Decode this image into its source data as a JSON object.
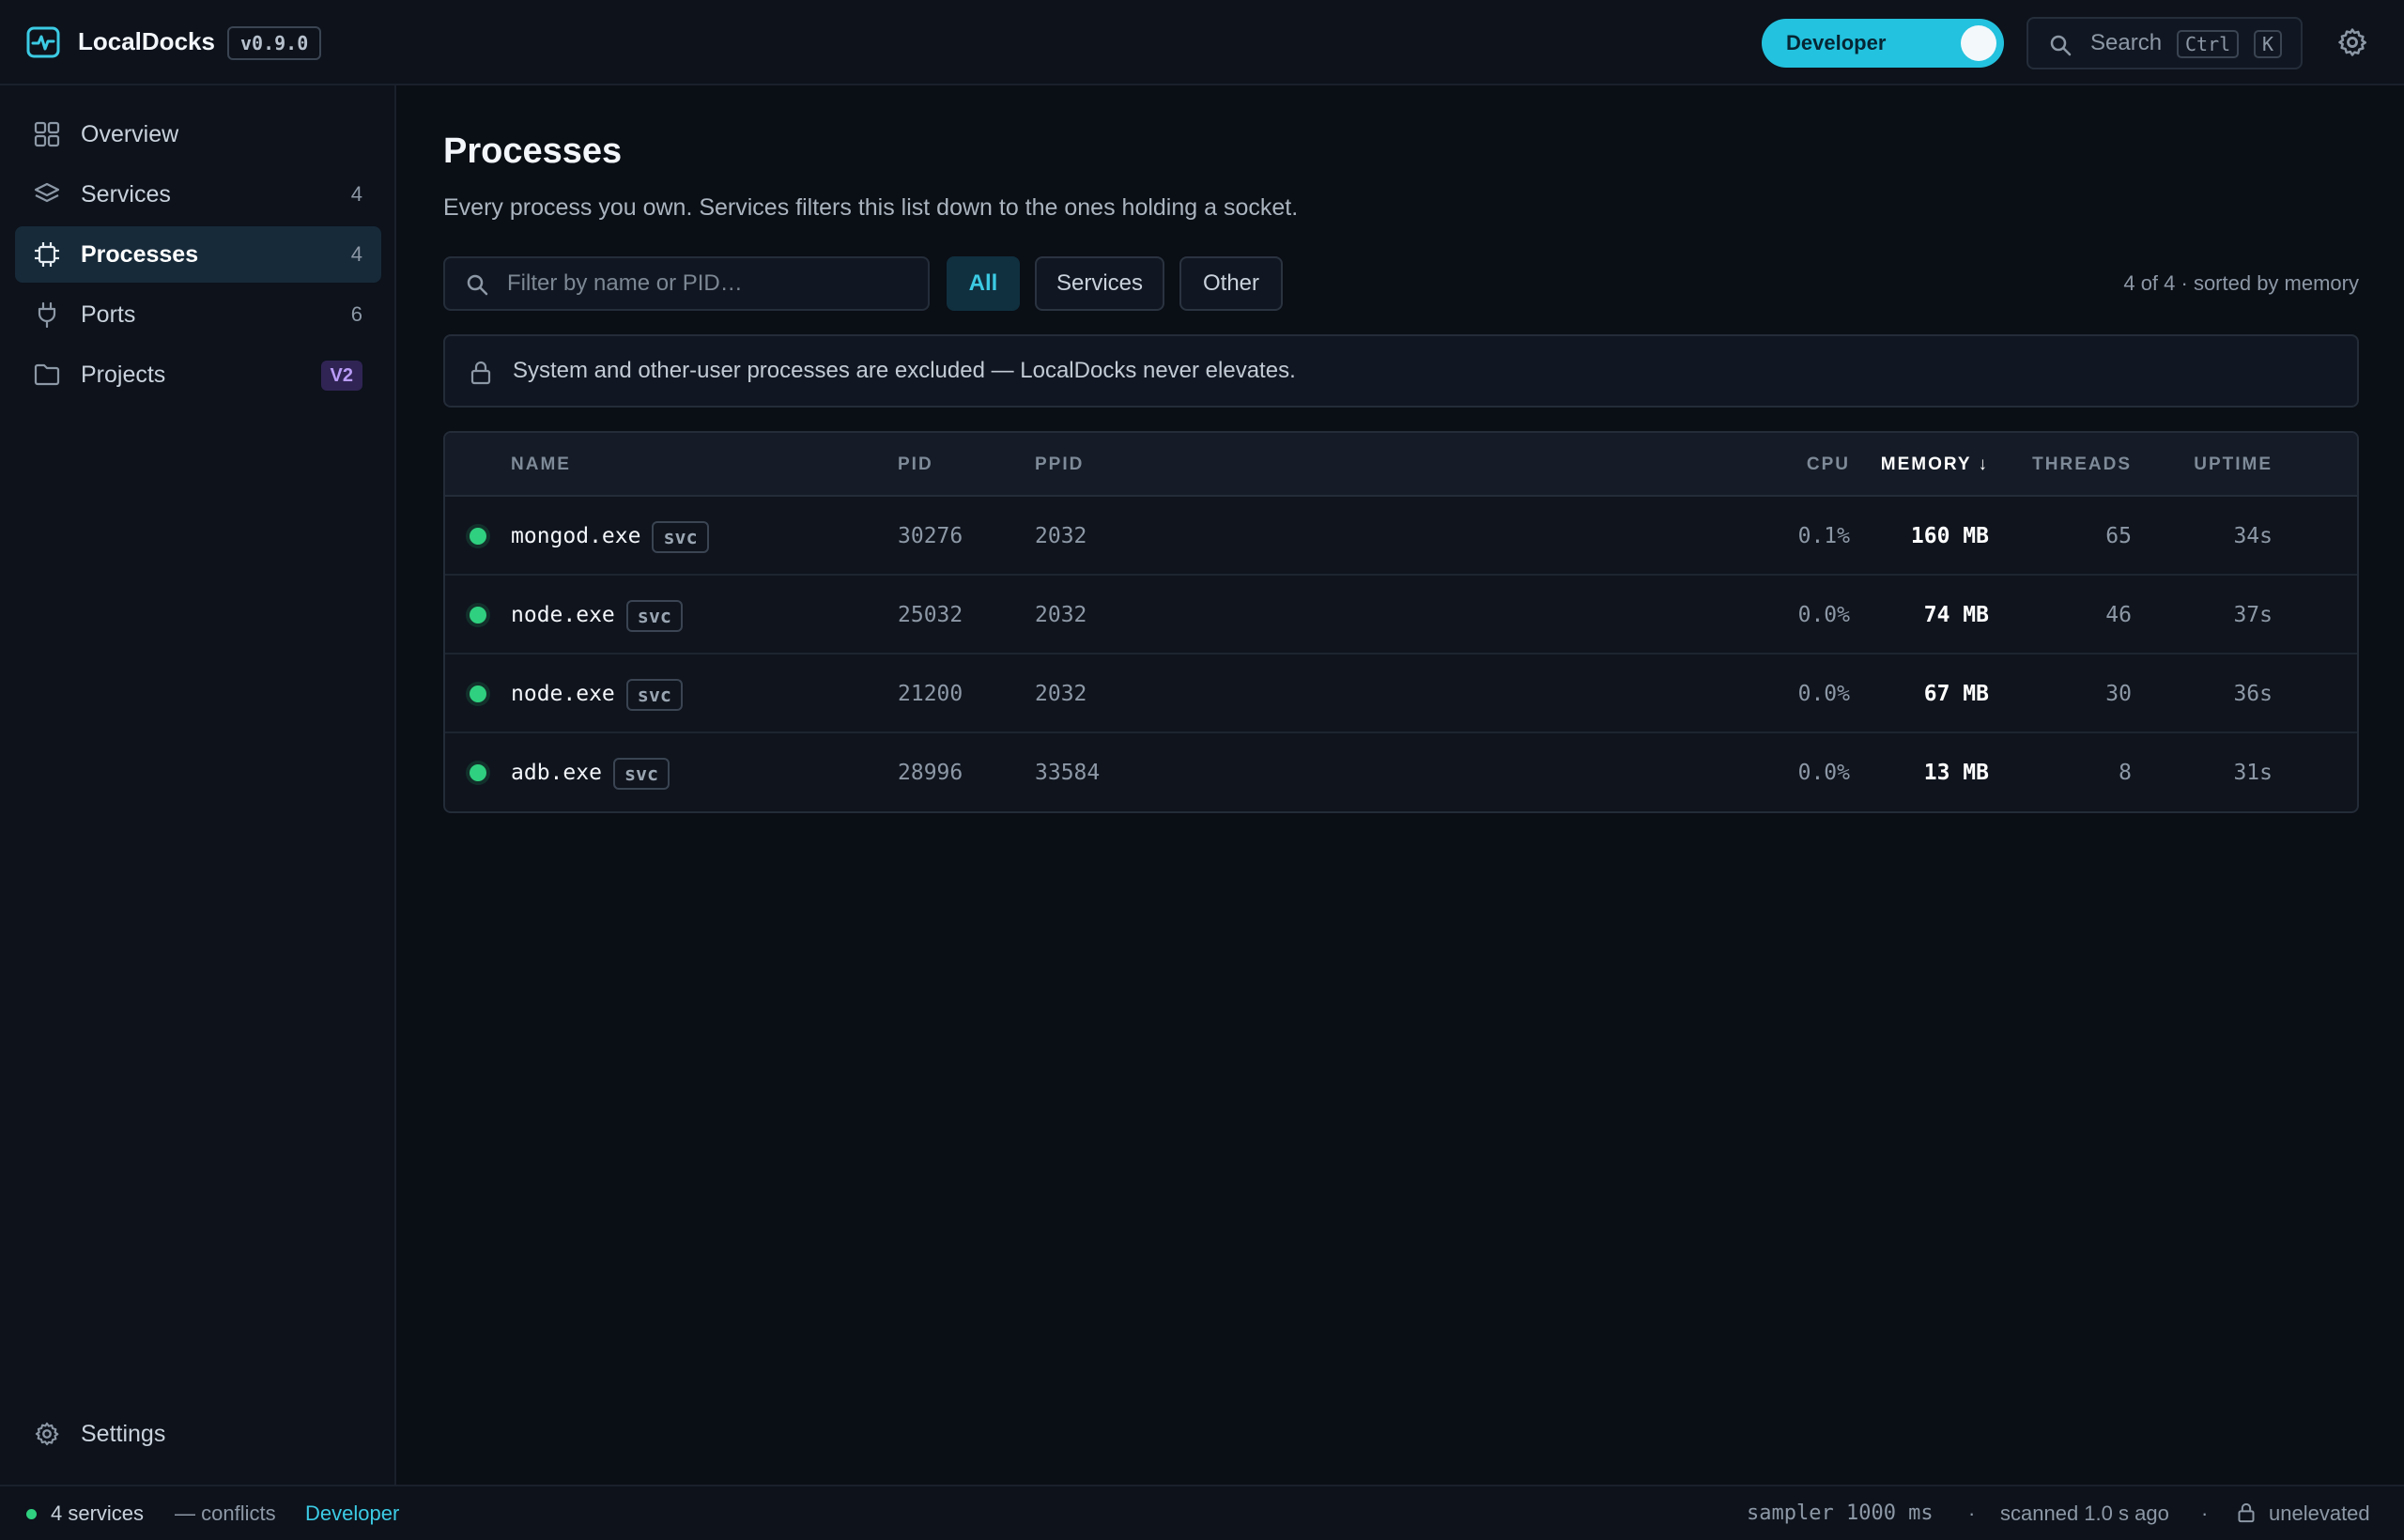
{
  "app": {
    "name": "LocalDocks",
    "version": "v0.9.0"
  },
  "topbar": {
    "mode_label": "Developer",
    "search_label": "Search",
    "shortcut_key1": "Ctrl",
    "shortcut_key2": "K"
  },
  "sidebar": {
    "items": [
      {
        "label": "Overview",
        "count": "",
        "icon": "grid-icon"
      },
      {
        "label": "Services",
        "count": "4",
        "icon": "layers-icon"
      },
      {
        "label": "Processes",
        "count": "4",
        "icon": "cpu-icon",
        "active": true
      },
      {
        "label": "Ports",
        "count": "6",
        "icon": "plug-icon"
      },
      {
        "label": "Projects",
        "badge": "V2",
        "icon": "folder-icon"
      }
    ],
    "settings_label": "Settings"
  },
  "main": {
    "title": "Processes",
    "subtitle": "Every process you own. Services filters this list down to the ones holding a socket.",
    "filter_placeholder": "Filter by name or PID…",
    "chips": [
      "All",
      "Services",
      "Other"
    ],
    "active_chip": "All",
    "result_meta": "4 of 4 · sorted by memory",
    "notice": "System and other-user processes are excluded — LocalDocks never elevates."
  },
  "table": {
    "headers": {
      "name": "NAME",
      "pid": "PID",
      "ppid": "PPID",
      "cpu": "CPU",
      "memory": "MEMORY ↓",
      "threads": "THREADS",
      "uptime": "UPTIME"
    },
    "tag_label": "svc",
    "rows": [
      {
        "name": "mongod.exe",
        "pid": "30276",
        "ppid": "2032",
        "cpu": "0.1%",
        "memory": "160 MB",
        "threads": "65",
        "uptime": "34s"
      },
      {
        "name": "node.exe",
        "pid": "25032",
        "ppid": "2032",
        "cpu": "0.0%",
        "memory": "74 MB",
        "threads": "46",
        "uptime": "37s"
      },
      {
        "name": "node.exe",
        "pid": "21200",
        "ppid": "2032",
        "cpu": "0.0%",
        "memory": "67 MB",
        "threads": "30",
        "uptime": "36s"
      },
      {
        "name": "adb.exe",
        "pid": "28996",
        "ppid": "33584",
        "cpu": "0.0%",
        "memory": "13 MB",
        "threads": "8",
        "uptime": "31s"
      }
    ]
  },
  "statusbar": {
    "services": "4 services",
    "conflicts": "— conflicts",
    "mode": "Developer",
    "sampler": "sampler 1000 ms",
    "sep": "·",
    "scanned": "scanned 1.0 s ago",
    "elevation": "unelevated"
  },
  "colors": {
    "accent": "#23c2de",
    "running": "#2fd07f",
    "badge_v2": "#b99cf7"
  }
}
